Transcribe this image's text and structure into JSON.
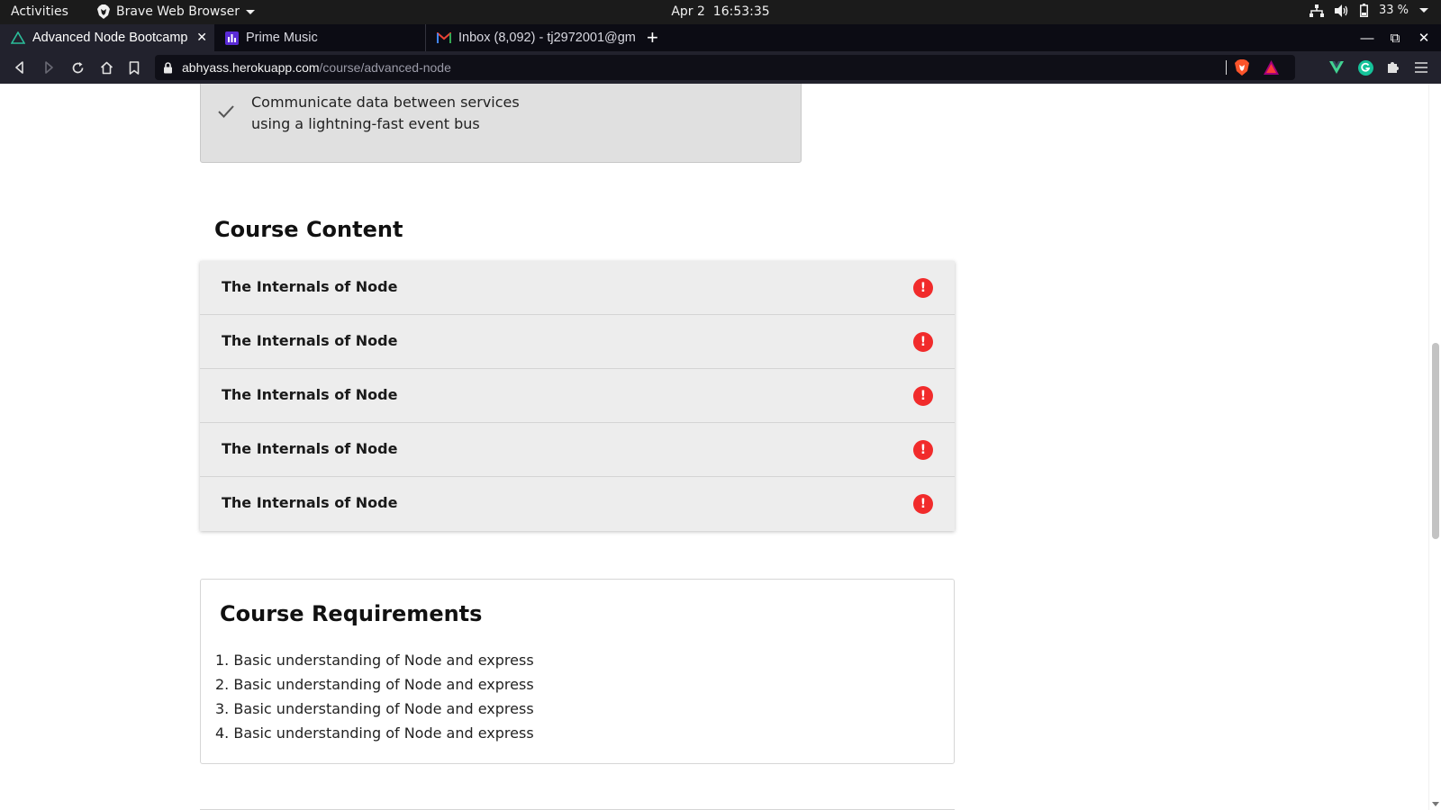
{
  "system_bar": {
    "activities": "Activities",
    "app_name": "Brave Web Browser",
    "date": "Apr 2",
    "time": "16:53:35",
    "battery": "33 %"
  },
  "tabs": [
    {
      "title": "Advanced Node Bootcamp",
      "close": "✕",
      "icon": "triangle-logo-icon",
      "active": true
    },
    {
      "title": "Prime Music",
      "icon": "prime-music-icon",
      "active": false
    },
    {
      "title": "Inbox (8,092) - tj2972001@gm",
      "icon": "gmail-icon",
      "active": false
    }
  ],
  "window_controls": {
    "new_tab": "+",
    "minimize": "—",
    "maximize": "⧉",
    "close": "✕"
  },
  "address_bar": {
    "host": "abhyass.herokuapp.com",
    "path": "/course/advanced-node"
  },
  "learn_item": {
    "line1": "Communicate data between services",
    "line2": "using a lightning-fast event bus"
  },
  "course_content": {
    "title": "Course Content",
    "sections": [
      {
        "label": "The Internals of Node",
        "badge": "!"
      },
      {
        "label": "The Internals of Node",
        "badge": "!"
      },
      {
        "label": "The Internals of Node",
        "badge": "!"
      },
      {
        "label": "The Internals of Node",
        "badge": "!"
      },
      {
        "label": "The Internals of Node",
        "badge": "!"
      }
    ]
  },
  "requirements": {
    "title": "Course Requirements",
    "items": [
      "1. Basic understanding of Node and express",
      "2. Basic understanding of Node and express",
      "3. Basic understanding of Node and express",
      "4. Basic understanding of Node and express"
    ]
  },
  "colors": {
    "alert": "#f12b2b",
    "toolbar_bg": "#22222d",
    "tabstrip_bg": "#0c0c14",
    "accordion_bg": "#ededed"
  }
}
